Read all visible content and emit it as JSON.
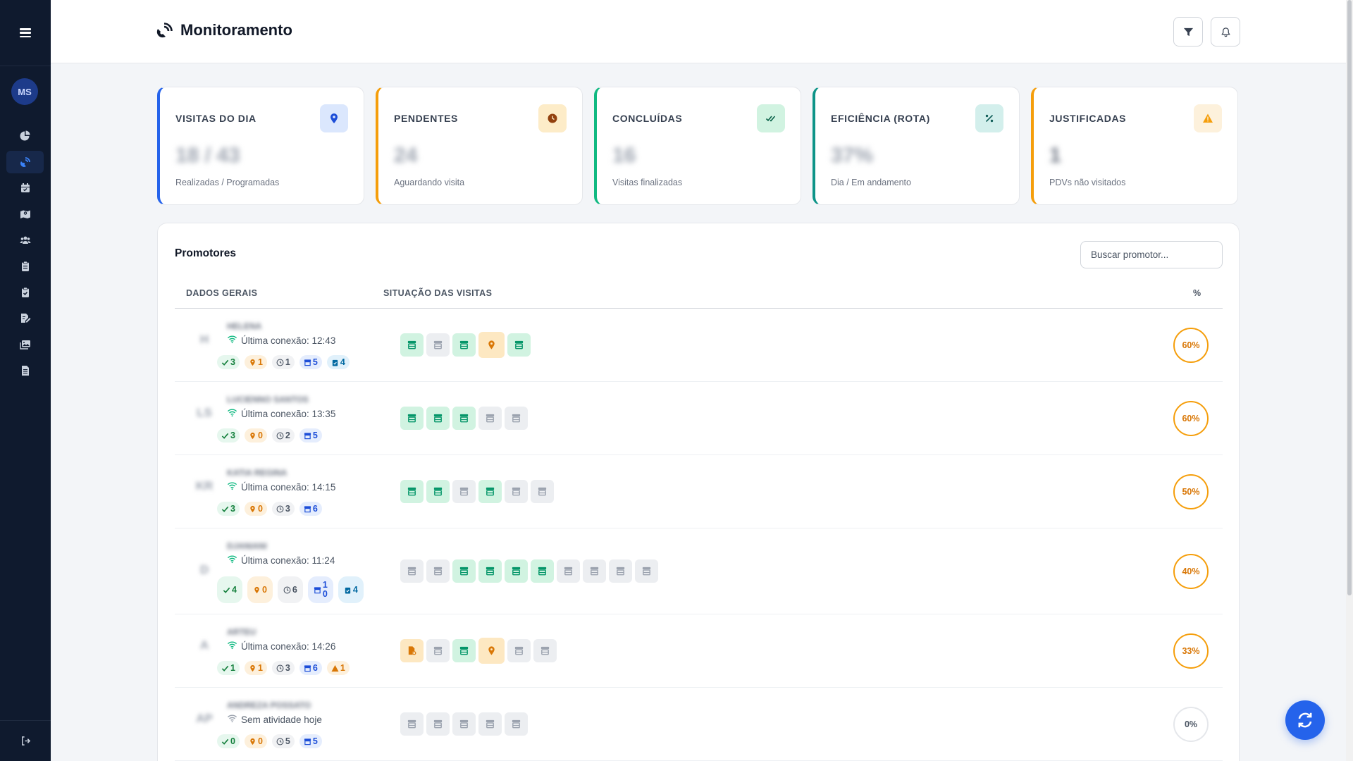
{
  "header": {
    "title": "Monitoramento"
  },
  "sidebar": {
    "avatar_initials": "MS"
  },
  "stats": [
    {
      "label": "VISITAS DO DIA",
      "value": "18 / 43",
      "sub": "Realizadas / Programadas",
      "accent": "#2563eb",
      "icon": "map-pin-icon"
    },
    {
      "label": "PENDENTES",
      "value": "24",
      "sub": "Aguardando visita",
      "accent": "#f59e0b",
      "icon": "clock-icon"
    },
    {
      "label": "CONCLUÍDAS",
      "value": "16",
      "sub": "Visitas finalizadas",
      "accent": "#10b981",
      "icon": "double-check-icon"
    },
    {
      "label": "EFICIÊNCIA (ROTA)",
      "value": "37%",
      "sub": "Dia / Em andamento",
      "accent": "#0d9488",
      "icon": "percent-icon"
    },
    {
      "label": "JUSTIFICADAS",
      "value": "1",
      "sub": "PDVs não visitados",
      "accent": "#f59e0b",
      "icon": "warning-icon"
    }
  ],
  "promotores": {
    "title": "Promotores",
    "search_placeholder": "Buscar promotor...",
    "col_dados": "DADOS GERAIS",
    "col_situacao": "SITUAÇÃO DAS VISITAS",
    "col_pct": "%",
    "rows": [
      {
        "initials": "H",
        "name": "HELENA",
        "conn": "Última conexão: 12:43",
        "online": true,
        "badges": {
          "done": "3",
          "loc": "1",
          "pend": "1",
          "total": "5",
          "extra": "4"
        },
        "visits": [
          "done",
          "pend",
          "done",
          "loc",
          "done"
        ],
        "pct": "60%"
      },
      {
        "initials": "LS",
        "name": "LUCIENNO SANTOS",
        "conn": "Última conexão: 13:35",
        "online": true,
        "badges": {
          "done": "3",
          "loc": "0",
          "pend": "2",
          "total": "5"
        },
        "visits": [
          "done",
          "done",
          "done",
          "pend",
          "pend"
        ],
        "pct": "60%"
      },
      {
        "initials": "KR",
        "name": "KATIA REGINA",
        "conn": "Última conexão: 14:15",
        "online": true,
        "badges": {
          "done": "3",
          "loc": "0",
          "pend": "3",
          "total": "6"
        },
        "visits": [
          "done",
          "done",
          "pend",
          "done",
          "pend",
          "pend"
        ],
        "pct": "50%"
      },
      {
        "initials": "D",
        "name": "DJANIANI",
        "conn": "Última conexão: 11:24",
        "online": true,
        "badges": {
          "done": "4",
          "loc": "0",
          "pend": "6",
          "total_top": "1",
          "total_bottom": "0",
          "extra": "4"
        },
        "visits": [
          "pend",
          "pend",
          "done",
          "done",
          "done",
          "done",
          "pend",
          "pend",
          "pend",
          "pend"
        ],
        "pct": "40%"
      },
      {
        "initials": "A",
        "name": "ARTEU",
        "conn": "Última conexão: 14:26",
        "online": true,
        "badges": {
          "done": "1",
          "loc": "1",
          "pend": "3",
          "total": "6",
          "warn": "1"
        },
        "visits": [
          "just",
          "pend",
          "done",
          "loc",
          "pend",
          "pend"
        ],
        "pct": "33%"
      },
      {
        "initials": "AP",
        "name": "ANDREZA POSSATO",
        "conn": "Sem atividade hoje",
        "online": false,
        "badges": {
          "done": "0",
          "loc": "0",
          "pend": "5",
          "total": "5"
        },
        "visits": [
          "pend",
          "pend",
          "pend",
          "pend",
          "pend"
        ],
        "pct": "0%"
      }
    ]
  }
}
